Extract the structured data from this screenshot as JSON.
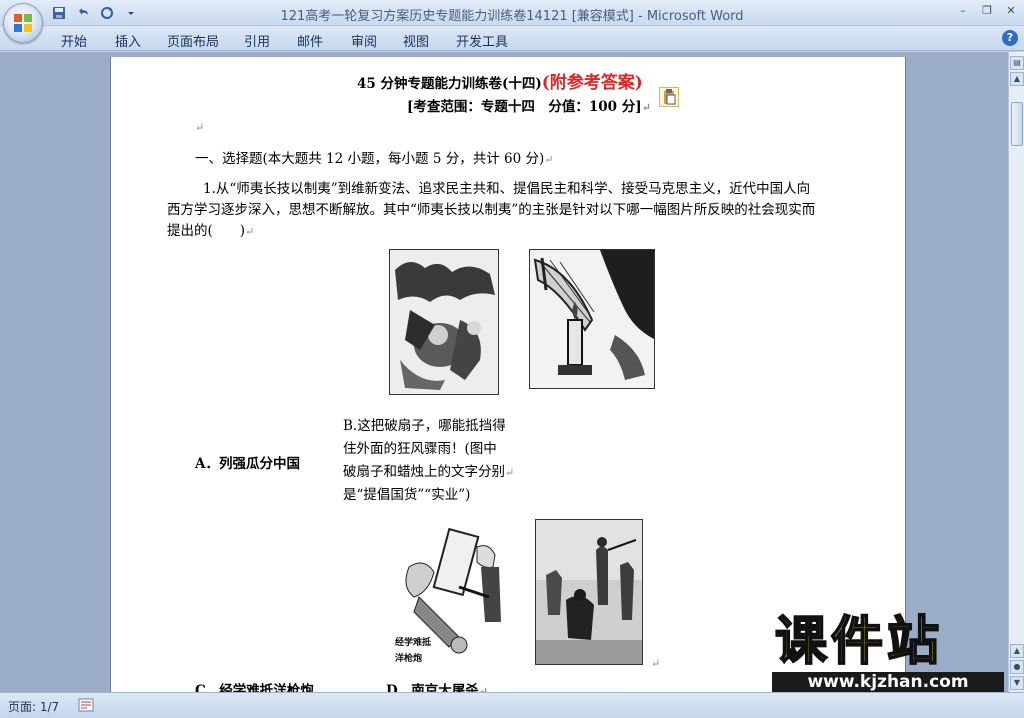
{
  "window": {
    "title": "121高考一轮复习方案历史专题能力训练卷14121 [兼容模式] - Microsoft Word",
    "minimize": "–",
    "restore": "❐",
    "close": "✕"
  },
  "ribbon": {
    "tabs": [
      "开始",
      "插入",
      "页面布局",
      "引用",
      "邮件",
      "审阅",
      "视图",
      "开发工具"
    ],
    "help": "?"
  },
  "doc": {
    "title_main": "45 分钟专题能力训练卷(十四)",
    "title_answer": "(附参考答案)",
    "scope": "[考查范围：专题十四　分值：100 分]",
    "section1": "一、选择题(本大题共 12 小题，每小题 5 分，共计 60 分)",
    "q1_line1": "1.从“师夷长技以制夷”到维新变法、追求民主共和、提倡民主和科学、接受马克思主义，近代中国人向",
    "q1_line2": "西方学习逐步深入，思想不断解放。其中“师夷长技以制夷”的主张是针对以下哪一幅图片所反映的社会现实而",
    "q1_line3": "提出的(　　)",
    "opt_a": "A．列强瓜分中国",
    "opt_b_1": "B.这把破扇子，哪能抵挡得",
    "opt_b_2": "住外面的狂风骤雨！(图中",
    "opt_b_3": "破扇子和蜡烛上的文字分别",
    "opt_b_4": "是“提倡国货”“实业”)",
    "opt_c": "C．经学难抵洋枪炮",
    "opt_d": "D．南京大屠杀",
    "cartoon_c_caption_1": "经学难抵",
    "cartoon_c_caption_2": "洋枪炮",
    "para_mark": "↵"
  },
  "statusbar": {
    "page": "页面: 1/7"
  },
  "watermark": {
    "title": "课件站",
    "url": "www.kjzhan.com"
  },
  "colors": {
    "answer_red": "#e0262a",
    "watermark_yellow": "#ffea00"
  }
}
